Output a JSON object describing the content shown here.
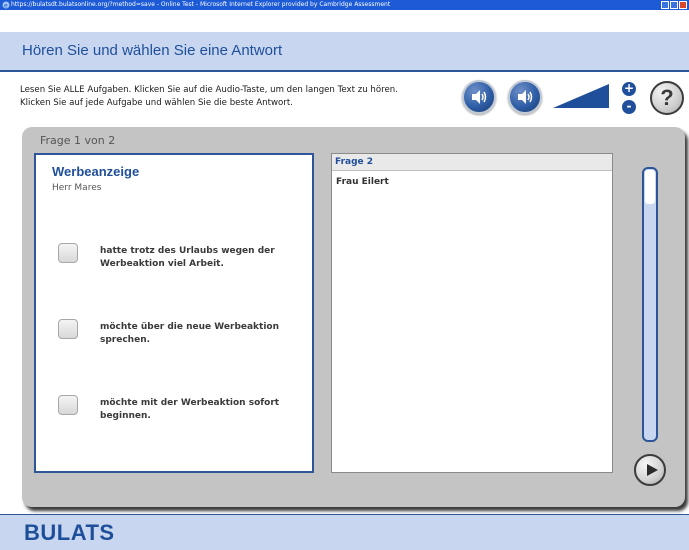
{
  "window": {
    "title": "https://bulatsdt.bulatsonline.org/?method=save - Online Test - Microsoft Internet Explorer provided by Cambridge Assessment"
  },
  "header": {
    "title": "Hören Sie und wählen Sie eine Antwort"
  },
  "instructions": {
    "line1": "Lesen Sie ALLE Aufgaben. Klicken Sie auf die Audio-Taste, um den langen Text zu hören.",
    "line2": "Klicken Sie auf jede Aufgabe und wählen Sie die beste Antwort."
  },
  "toolbar": {
    "audio_icon": "speaker-icon",
    "volume_icon": "volume-slider",
    "help_label": "?",
    "plus_label": "+",
    "minus_label": "-"
  },
  "question": {
    "progress": "Frage 1 von 2",
    "title": "Werbeanzeige",
    "speaker": "Herr Mares",
    "options": [
      "hatte trotz des Urlaubs wegen der Werbeaktion viel Arbeit.",
      "möchte über die neue Werbeaktion sprechen.",
      "möchte mit der Werbeaktion sofort beginnen."
    ]
  },
  "next_panel": {
    "heading": "Frage 2",
    "speaker": "Frau Eilert"
  },
  "footer": {
    "brand": "BULATS"
  },
  "colors": {
    "accent": "#1f4f9a",
    "band": "#c8d7ef",
    "panel": "#c4c4c4"
  }
}
